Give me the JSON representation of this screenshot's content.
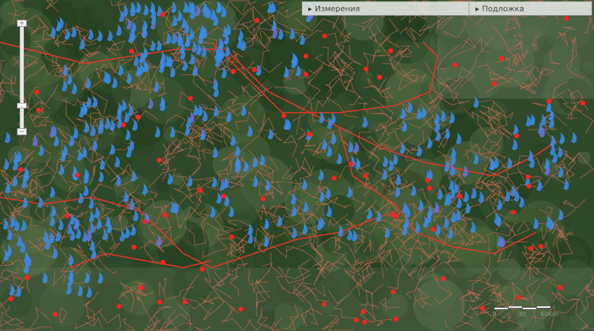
{
  "panels": {
    "measure": "Измерения",
    "basemap": "Подложка"
  },
  "zoom_control": {
    "plus": "+",
    "minus": "−"
  },
  "scale": {
    "labels": [
      "0",
      "30",
      "60km"
    ]
  },
  "colors": {
    "roads": "#c86a55",
    "major_roads": "#e8342c",
    "fire_marker": "#3a8cf0",
    "settlement": "#ff2020",
    "forest": "#2f4a2a"
  },
  "icons": {
    "fire": "fire-icon",
    "settlement": "settlement-dot"
  }
}
